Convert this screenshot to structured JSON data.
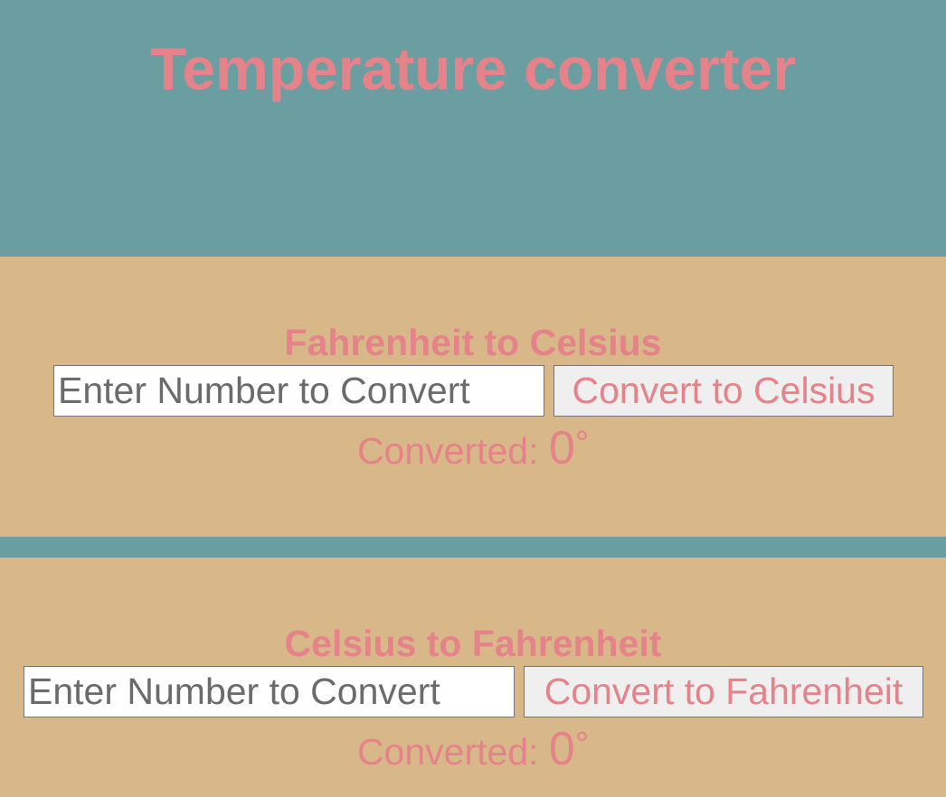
{
  "header": {
    "title": "Temperature converter"
  },
  "sections": [
    {
      "heading": "Fahrenheit to Celsius",
      "input_placeholder": "Enter Number to Convert",
      "button_label": "Convert to Celsius",
      "result_label": "Converted: ",
      "result_value": "0",
      "result_unit": "°"
    },
    {
      "heading": "Celsius to Fahrenheit",
      "input_placeholder": "Enter Number to Convert",
      "button_label": "Convert to Fahrenheit",
      "result_label": "Converted: ",
      "result_value": "0",
      "result_unit": "°"
    }
  ],
  "colors": {
    "header_bg": "#6a9ea1",
    "section_bg": "#d8b889",
    "accent_text": "#e6828a",
    "button_bg": "#efefef"
  }
}
